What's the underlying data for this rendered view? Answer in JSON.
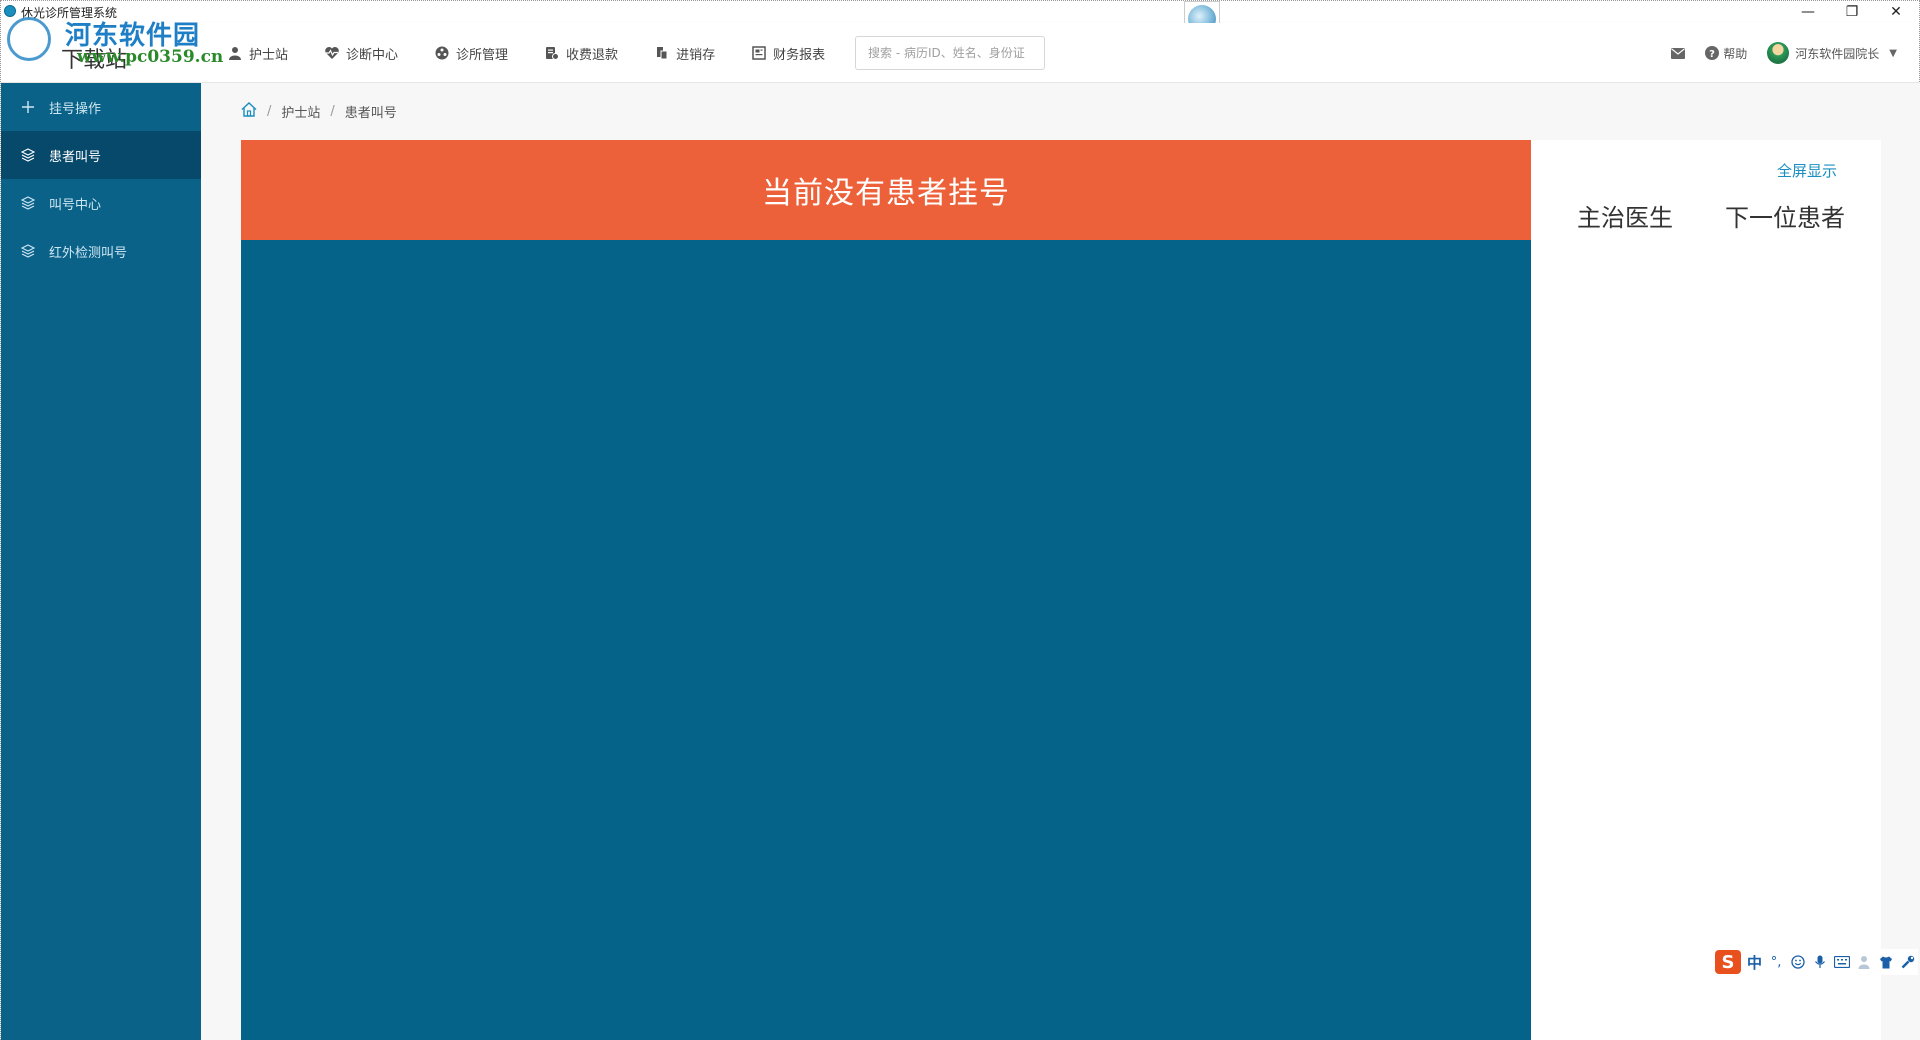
{
  "window": {
    "title": "休光诊所管理系统",
    "controls": [
      "—",
      "❐",
      "✕"
    ]
  },
  "watermark": {
    "title": "河东软件园",
    "subtitle": "下载站",
    "url": "www.pc0359.cn"
  },
  "topnav": {
    "menu": [
      {
        "label": "护士站",
        "icon": "nurse-icon"
      },
      {
        "label": "诊断中心",
        "icon": "heartbeat-icon"
      },
      {
        "label": "诊所管理",
        "icon": "settings-wheel-icon"
      },
      {
        "label": "收费退款",
        "icon": "billing-icon"
      },
      {
        "label": "进销存",
        "icon": "inventory-icon"
      },
      {
        "label": "财务报表",
        "icon": "report-icon"
      }
    ],
    "search_placeholder": "搜索 - 病历ID、姓名、身份证",
    "help_label": "帮助",
    "user_label": "河东软件园院长",
    "user_caret": "▼"
  },
  "sidebar": {
    "items": [
      {
        "label": "挂号操作",
        "icon": "plus-icon",
        "active": false
      },
      {
        "label": "患者叫号",
        "icon": "layers-icon",
        "active": true
      },
      {
        "label": "叫号中心",
        "icon": "layers-icon",
        "active": false
      },
      {
        "label": "红外检测叫号",
        "icon": "layers-icon",
        "active": false
      }
    ]
  },
  "breadcrumb": {
    "items": [
      "护士站",
      "患者叫号"
    ],
    "separator": "/"
  },
  "call_panel": {
    "message": "当前没有患者挂号"
  },
  "side_panel": {
    "fullscreen_label": "全屏显示",
    "col_doctor": "主治医生",
    "col_next": "下一位患者"
  },
  "ime": {
    "logo": "S",
    "mode": "中",
    "punct": "°,"
  },
  "colors": {
    "sidebar": "#0b6289",
    "sidebar_active": "#07496a",
    "call_panel": "#056289",
    "call_header": "#ec6139",
    "link": "#1a8fbf"
  }
}
